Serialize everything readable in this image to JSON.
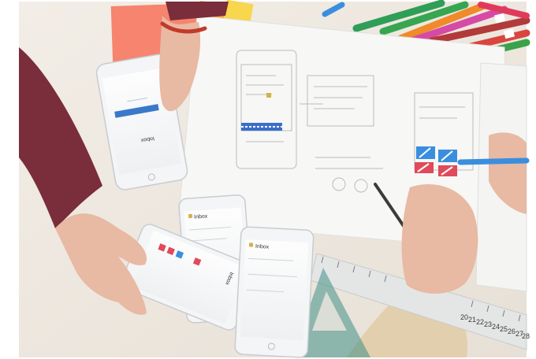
{
  "photo": {
    "subject": "team sketching mobile app wireframes on paper with smartphones",
    "colors": {
      "table": "#efe9e1",
      "paper": "#f7f7f5",
      "sleeve_maroon": "#7a2d3a",
      "sleeve_beige": "#e2cfae",
      "skin": "#e8b9a3",
      "accent_blue": "#3a8ede",
      "accent_red": "#e04a5a",
      "sticky_pink": "#f47a8c",
      "sticky_orange": "#f5a04a",
      "sticky_yellow": "#f7cf4a",
      "ruler": "#e4e6e6",
      "triangle": "#3f8f86"
    }
  },
  "phones": [
    {
      "app_label": "Inbox"
    },
    {
      "app_label": "Inbox"
    },
    {
      "app_label": "Inbox"
    },
    {
      "app_label": "Inbox"
    }
  ],
  "ruler": {
    "numbers": [
      "20",
      "21",
      "22",
      "23",
      "24",
      "25",
      "26",
      "27",
      "28"
    ]
  }
}
